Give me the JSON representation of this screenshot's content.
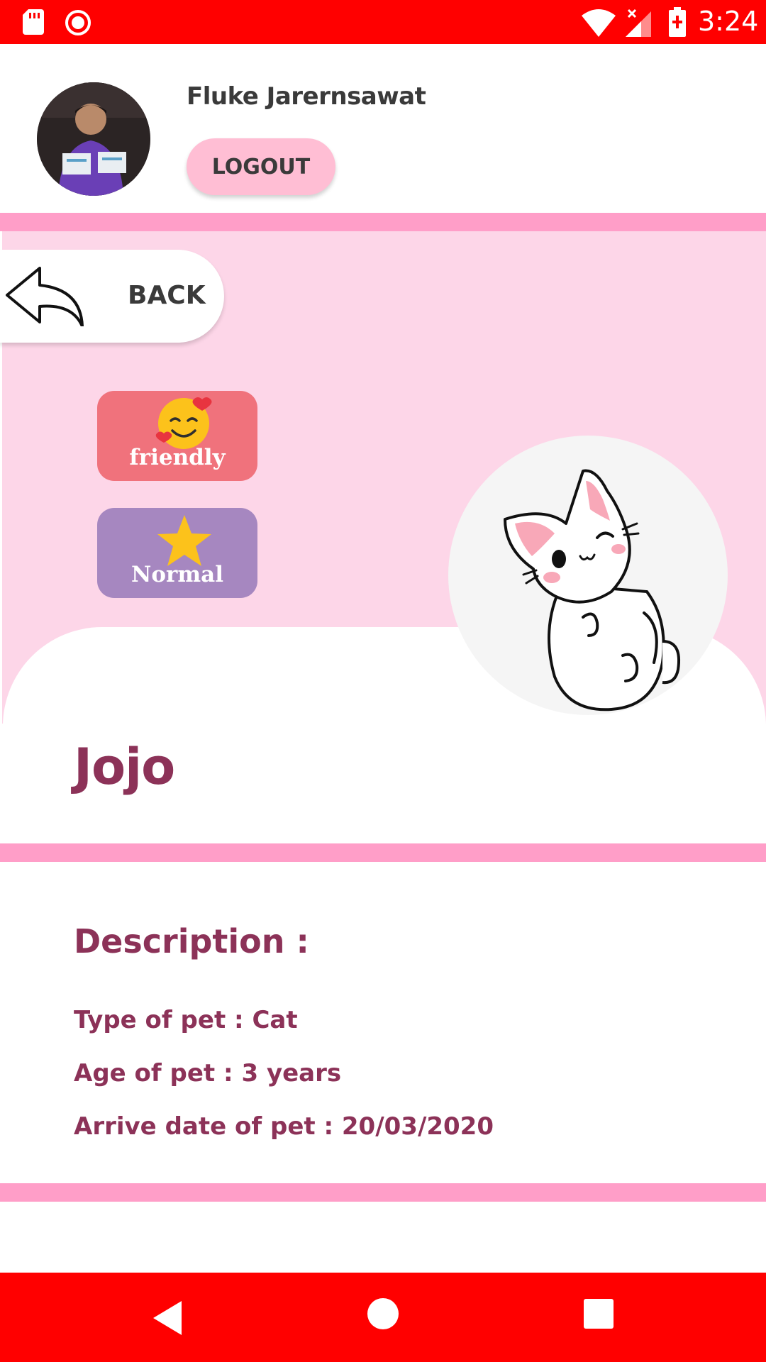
{
  "status_bar": {
    "time": "3:24",
    "icons": [
      "sd-card-icon",
      "record-icon",
      "wifi-icon",
      "signal-icon",
      "battery-charging-icon"
    ],
    "color": "#ff0000"
  },
  "header": {
    "user_name": "Fluke Jarernsawat",
    "logout_label": "LOGOUT"
  },
  "back_button": {
    "label": "BACK",
    "icon": "back-arrow-icon"
  },
  "traits": [
    {
      "label": "friendly",
      "icon": "smiling-face-hearts-icon",
      "color": "#f0727c"
    },
    {
      "label": "Normal",
      "icon": "star-icon",
      "color": "#a687c0"
    }
  ],
  "pet": {
    "name": "Jojo",
    "image": "cat-illustration-icon"
  },
  "description": {
    "title": "Description :",
    "lines": [
      "Type of pet : Cat",
      "Age of pet : 3 years",
      "Arrive date of pet : 20/03/2020"
    ]
  },
  "nav_bar": {
    "icons": [
      "nav-back-icon",
      "nav-home-icon",
      "nav-recent-icon"
    ]
  },
  "colors": {
    "accent_pink": "#ff9ec8",
    "hero_pink": "#fdd6e8",
    "logout_pink": "#ffbed4",
    "text_plum": "#8c3258",
    "system_red": "#ff0000"
  }
}
